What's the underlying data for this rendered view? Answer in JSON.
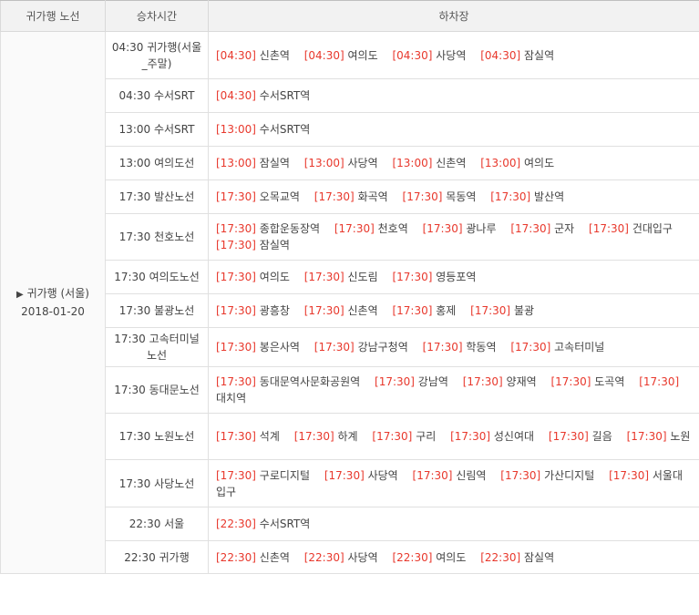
{
  "headers": {
    "route": "귀가행 노선",
    "time": "승차시간",
    "stops": "하차장"
  },
  "route_cell": {
    "arrow": "▶",
    "name": "귀가행 (서울)",
    "date": "2018-01-20"
  },
  "rows": [
    {
      "time": "04:30 귀가행(서울_주말)",
      "stops": [
        {
          "t": "[04:30]",
          "n": "신촌역"
        },
        {
          "t": "[04:30]",
          "n": "여의도"
        },
        {
          "t": "[04:30]",
          "n": "사당역"
        },
        {
          "t": "[04:30]",
          "n": "잠실역"
        }
      ]
    },
    {
      "time": "04:30 수서SRT",
      "stops": [
        {
          "t": "[04:30]",
          "n": "수서SRT역"
        }
      ]
    },
    {
      "time": "13:00 수서SRT",
      "stops": [
        {
          "t": "[13:00]",
          "n": "수서SRT역"
        }
      ]
    },
    {
      "time": "13:00 여의도선",
      "stops": [
        {
          "t": "[13:00]",
          "n": "잠실역"
        },
        {
          "t": "[13:00]",
          "n": "사당역"
        },
        {
          "t": "[13:00]",
          "n": "신촌역"
        },
        {
          "t": "[13:00]",
          "n": "여의도"
        }
      ]
    },
    {
      "time": "17:30 발산노선",
      "stops": [
        {
          "t": "[17:30]",
          "n": "오목교역"
        },
        {
          "t": "[17:30]",
          "n": "화곡역"
        },
        {
          "t": "[17:30]",
          "n": "목동역"
        },
        {
          "t": "[17:30]",
          "n": "발산역"
        }
      ]
    },
    {
      "time": "17:30 천호노선",
      "stops": [
        {
          "t": "[17:30]",
          "n": "종합운동장역"
        },
        {
          "t": "[17:30]",
          "n": "천호역"
        },
        {
          "t": "[17:30]",
          "n": "광나루"
        },
        {
          "t": "[17:30]",
          "n": "군자"
        },
        {
          "t": "[17:30]",
          "n": "건대입구"
        },
        {
          "t": "[17:30]",
          "n": "잠실역"
        }
      ]
    },
    {
      "time": "17:30 여의도노선",
      "stops": [
        {
          "t": "[17:30]",
          "n": "여의도"
        },
        {
          "t": "[17:30]",
          "n": "신도림"
        },
        {
          "t": "[17:30]",
          "n": "영등포역"
        }
      ]
    },
    {
      "time": "17:30 불광노선",
      "stops": [
        {
          "t": "[17:30]",
          "n": "광흥창"
        },
        {
          "t": "[17:30]",
          "n": "신촌역"
        },
        {
          "t": "[17:30]",
          "n": "홍제"
        },
        {
          "t": "[17:30]",
          "n": "불광"
        }
      ]
    },
    {
      "time": "17:30 고속터미널노선",
      "stops": [
        {
          "t": "[17:30]",
          "n": "봉은사역"
        },
        {
          "t": "[17:30]",
          "n": "강남구청역"
        },
        {
          "t": "[17:30]",
          "n": "학동역"
        },
        {
          "t": "[17:30]",
          "n": "고속터미널"
        }
      ]
    },
    {
      "time": "17:30 동대문노선",
      "stops": [
        {
          "t": "[17:30]",
          "n": "동대문역사문화공원역"
        },
        {
          "t": "[17:30]",
          "n": "강남역"
        },
        {
          "t": "[17:30]",
          "n": "양재역"
        },
        {
          "t": "[17:30]",
          "n": "도곡역"
        },
        {
          "t": "[17:30]",
          "n": "대치역"
        }
      ]
    },
    {
      "time": "17:30 노원노선",
      "stops": [
        {
          "t": "[17:30]",
          "n": "석계"
        },
        {
          "t": "[17:30]",
          "n": "하계"
        },
        {
          "t": "[17:30]",
          "n": "구리"
        },
        {
          "t": "[17:30]",
          "n": "성신여대"
        },
        {
          "t": "[17:30]",
          "n": "길음"
        },
        {
          "t": "[17:30]",
          "n": "노원"
        }
      ]
    },
    {
      "time": "17:30 사당노선",
      "stops": [
        {
          "t": "[17:30]",
          "n": "구로디지털"
        },
        {
          "t": "[17:30]",
          "n": "사당역"
        },
        {
          "t": "[17:30]",
          "n": "신림역"
        },
        {
          "t": "[17:30]",
          "n": "가산디지털"
        },
        {
          "t": "[17:30]",
          "n": "서울대입구"
        }
      ]
    },
    {
      "time": "22:30 서울",
      "stops": [
        {
          "t": "[22:30]",
          "n": "수서SRT역"
        }
      ]
    },
    {
      "time": "22:30 귀가행",
      "stops": [
        {
          "t": "[22:30]",
          "n": "신촌역"
        },
        {
          "t": "[22:30]",
          "n": "사당역"
        },
        {
          "t": "[22:30]",
          "n": "여의도"
        },
        {
          "t": "[22:30]",
          "n": "잠실역"
        }
      ]
    }
  ],
  "colors": {
    "time_accent": "#e8382c",
    "header_bg": "#f2f2f2",
    "border": "#e0e0e0"
  }
}
